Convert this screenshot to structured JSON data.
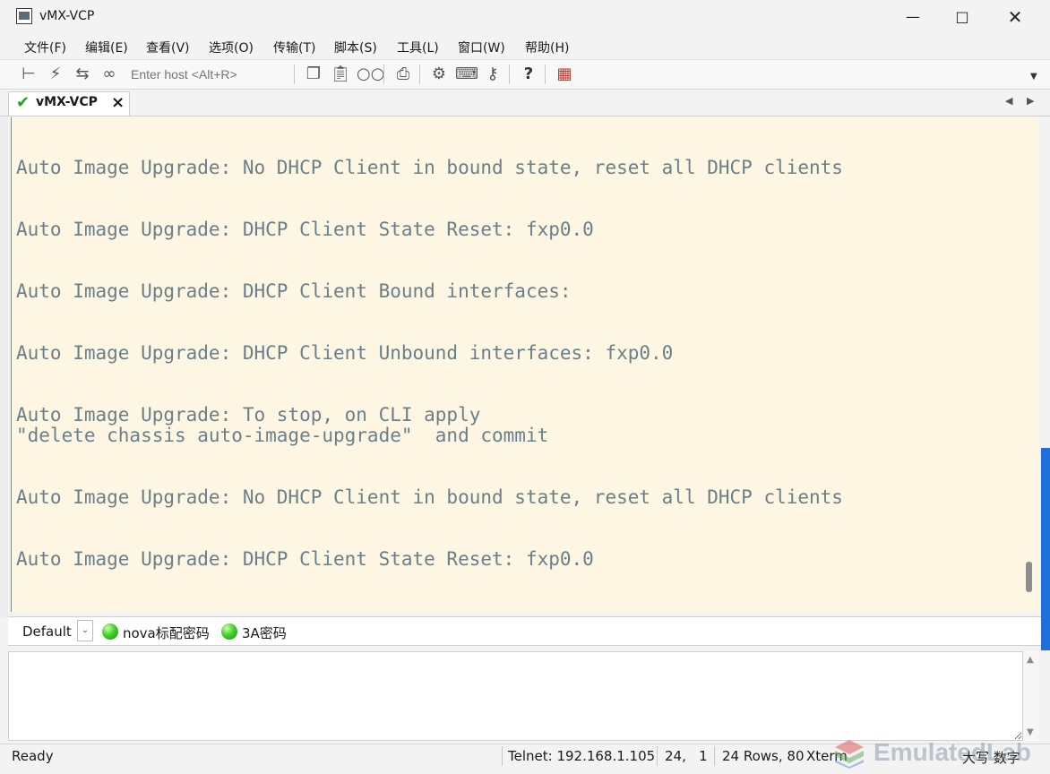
{
  "window": {
    "title": "vMX-VCP"
  },
  "menubar": {
    "items": [
      "文件(F)",
      "编辑(E)",
      "查看(V)",
      "选项(O)",
      "传输(T)",
      "脚本(S)",
      "工具(L)",
      "窗口(W)",
      "帮助(H)"
    ]
  },
  "toolbar": {
    "host_placeholder": "Enter host <Alt+R>"
  },
  "tabs": [
    {
      "label": "vMX-VCP",
      "close": "×"
    }
  ],
  "terminal": {
    "lines": [
      {
        "text": "Auto Image Upgrade: No DHCP Client in bound state, reset all DHCP clients"
      },
      {
        "text": "Auto Image Upgrade: DHCP Client State Reset: fxp0.0"
      },
      {
        "text": "Auto Image Upgrade: DHCP Client Bound interfaces:"
      },
      {
        "text": "Auto Image Upgrade: DHCP Client Unbound interfaces: fxp0.0"
      },
      {
        "text": "Auto Image Upgrade: To stop, on CLI apply"
      },
      {
        "text": "\"delete chassis auto-image-upgrade\"  and commit"
      },
      {
        "text": "Auto Image Upgrade: No DHCP Client in bound state, reset all DHCP clients"
      },
      {
        "text": "Auto Image Upgrade: DHCP Client State Reset: fxp0.0"
      }
    ]
  },
  "buttonbar": {
    "session_select": "Default",
    "buttons": [
      {
        "label": "nova标配密码"
      },
      {
        "label": "3A密码"
      }
    ]
  },
  "statusbar": {
    "ready": "Ready",
    "connection": "Telnet: 192.168.1.105",
    "cursor": "24,   1",
    "size": "24 Rows, 80",
    "terminal_type": "Xterm",
    "caps": "大写 数字"
  },
  "watermark": {
    "text": "EmulatedLab"
  },
  "colors": {
    "terminal_bg": "#fdf6e3",
    "terminal_fg": "#6b7f8a",
    "status_dot": "#43d12a"
  }
}
